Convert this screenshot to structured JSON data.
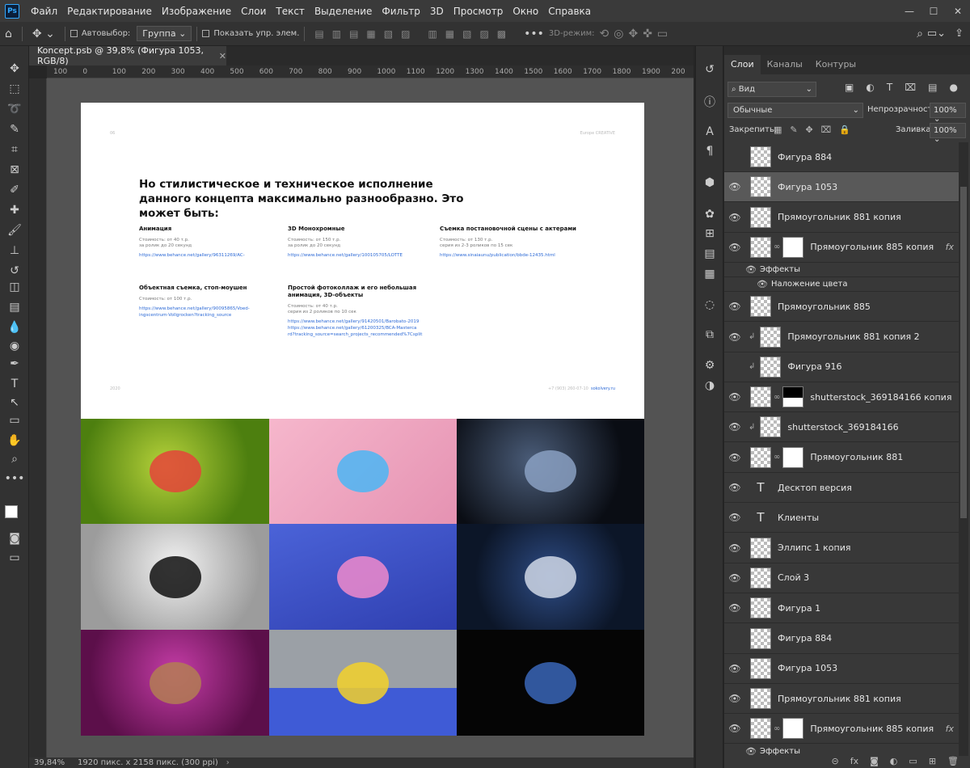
{
  "app": {
    "logo": "Ps"
  },
  "menu": [
    "Файл",
    "Редактирование",
    "Изображение",
    "Слои",
    "Текст",
    "Выделение",
    "Фильтр",
    "3D",
    "Просмотр",
    "Окно",
    "Справка"
  ],
  "options": {
    "autoselect": "Автовыбор:",
    "group": "Группа",
    "show_controls": "Показать упр. элем.",
    "mode3d": "3D-режим:"
  },
  "document_tab": "Koncept.psb @ 39,8% (Фигура 1053, RGB/8)",
  "ruler_ticks": [
    "100",
    "0",
    "100",
    "200",
    "300",
    "400",
    "500",
    "600",
    "700",
    "800",
    "900",
    "1000",
    "1100",
    "1200",
    "1300",
    "1400",
    "1500",
    "1600",
    "1700",
    "1800",
    "1900",
    "200"
  ],
  "status": {
    "zoom": "39,84%",
    "info": "1920 пикс. x 2158 пикс. (300 ppi)"
  },
  "doc": {
    "page_num": "06",
    "brand": "Europe CREATIVE",
    "heading": "Но стилистическое и техническое исполнение данного концепта максимально разнообразно. Это может быть:",
    "items": [
      {
        "title": "Анимация",
        "price": "Стоимость: от 40 т.р.",
        "note": "за ролик до 20 секунд",
        "links": [
          "https://www.behance.net/gallery/96311269/AC-"
        ]
      },
      {
        "title": "3D Монохромные",
        "price": "Стоимость: от 150 т.р.",
        "note": "за ролик до 20 секунд",
        "links": [
          "https://www.behance.net/gallery/100105705/LOTTE"
        ]
      },
      {
        "title": "Съемка постановочной сцены с актерами",
        "price": "Стоимость: от 130 т.р.",
        "note": "серия из 2-3 роликов по 15 сек",
        "links": [
          "https://www.sinaiaunu/publication/bbde-12435.html"
        ]
      },
      {
        "title": "Объектная съемка, стоп-моушен",
        "price": "Стоимость: от 100 т.р.",
        "note": "",
        "links": [
          "https://www.behance.net/gallery/90095865/Voed-",
          "ingscentrum-Vollgrocken?tracking_source"
        ]
      },
      {
        "title": "Простой фотоколлаж и его небольшая анимация, 3D-объекты",
        "price": "Стоимость: от 40 т.р.",
        "note": "серия из 2 роликов по 10 сек",
        "links": [
          "https://www.behance.net/gallery/91420501/Barobato-2019",
          "https://www.behance.net/gallery/61200325/BCA-Masterca",
          "rd?tracking_source=search_projects_recommended%7Csplit"
        ]
      }
    ],
    "footer_left": "2020",
    "footer_phone": "+7 (903) 260-07-10",
    "footer_site": "sokolvery.ru"
  },
  "panel": {
    "tabs": [
      "Слои",
      "Каналы",
      "Контуры"
    ],
    "filter": "Вид",
    "blend": "Обычные",
    "opacity_label": "Непрозрачность:",
    "opacity": "100%",
    "lock_label": "Закрепить:",
    "fill_label": "Заливка:",
    "fill": "100%"
  },
  "layers": [
    {
      "name": "Фигура 884",
      "visible": false,
      "type": "shape"
    },
    {
      "name": "Фигура 1053",
      "visible": true,
      "type": "shape",
      "selected": true
    },
    {
      "name": "Прямоугольник 881 копия",
      "visible": true,
      "type": "shape"
    },
    {
      "name": "Прямоугольник 885 копия",
      "visible": true,
      "type": "masked",
      "fx": true
    },
    {
      "name": "Эффекты",
      "visible": true,
      "type": "effect"
    },
    {
      "name": "Наложение цвета",
      "visible": true,
      "type": "effect2"
    },
    {
      "name": "Прямоугольник 885",
      "visible": true,
      "type": "shape"
    },
    {
      "name": "Прямоугольник 881 копия 2",
      "visible": true,
      "type": "clipped"
    },
    {
      "name": "Фигура 916",
      "visible": false,
      "type": "clipped"
    },
    {
      "name": "shutterstock_369184166 копия",
      "visible": true,
      "type": "masked-dark"
    },
    {
      "name": "shutterstock_369184166",
      "visible": true,
      "type": "clipped"
    },
    {
      "name": "Прямоугольник 881",
      "visible": true,
      "type": "masked"
    },
    {
      "name": "Десктоп версия",
      "visible": true,
      "type": "text"
    },
    {
      "name": "Клиенты",
      "visible": true,
      "type": "text"
    },
    {
      "name": "Эллипс 1 копия",
      "visible": true,
      "type": "shape"
    },
    {
      "name": "Слой 3",
      "visible": true,
      "type": "shape"
    },
    {
      "name": "Фигура 1",
      "visible": true,
      "type": "shape"
    },
    {
      "name": "Фигура 884",
      "visible": false,
      "type": "shape"
    },
    {
      "name": "Фигура 1053",
      "visible": true,
      "type": "shape"
    },
    {
      "name": "Прямоугольник 881 копия",
      "visible": true,
      "type": "shape"
    },
    {
      "name": "Прямоугольник 885 копия",
      "visible": true,
      "type": "masked",
      "fx": true
    },
    {
      "name": "Эффекты",
      "visible": true,
      "type": "effect"
    }
  ],
  "colors": {
    "accent": "#31a8ff",
    "bg": "#262626",
    "panel": "#383838",
    "link": "#2d6ad6"
  }
}
